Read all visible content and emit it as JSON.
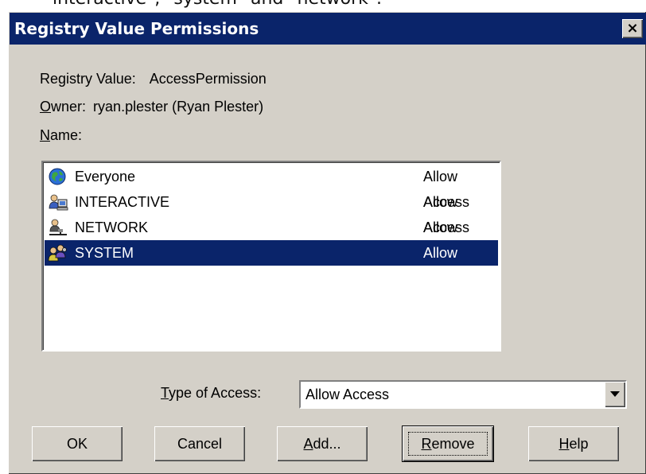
{
  "background_text": "interactive\", \"system\" and \"network\".",
  "window": {
    "title": "Registry Value Permissions",
    "close_symbol": "×"
  },
  "info": {
    "registry_value_label": "Registry Value:",
    "registry_value": "AccessPermission",
    "owner_label_key": "O",
    "owner_label_rest": "wner:",
    "owner_value": "ryan.plester (Ryan Plester)",
    "name_label_key": "N",
    "name_label_rest": "ame:"
  },
  "list": {
    "rows": [
      {
        "name": "Everyone",
        "access": "Allow Access",
        "icon": "globe-icon",
        "selected": false
      },
      {
        "name": "INTERACTIVE",
        "access": "Allow Access",
        "icon": "interactive-users-icon",
        "selected": false
      },
      {
        "name": "NETWORK",
        "access": "Allow Access",
        "icon": "network-user-icon",
        "selected": false
      },
      {
        "name": "SYSTEM",
        "access": "Allow Access",
        "icon": "system-users-icon",
        "selected": true
      }
    ]
  },
  "type_of_access": {
    "label_key": "T",
    "label_rest": "ype of Access:",
    "value": "Allow Access"
  },
  "buttons": {
    "ok": "OK",
    "cancel": "Cancel",
    "add_key": "A",
    "add_rest": "dd...",
    "remove_key": "R",
    "remove_rest": "emove",
    "help_key": "H",
    "help_rest": "elp"
  },
  "colors": {
    "titlebar": "#0a246a",
    "face": "#d4d0c8",
    "selection": "#0a246a"
  }
}
